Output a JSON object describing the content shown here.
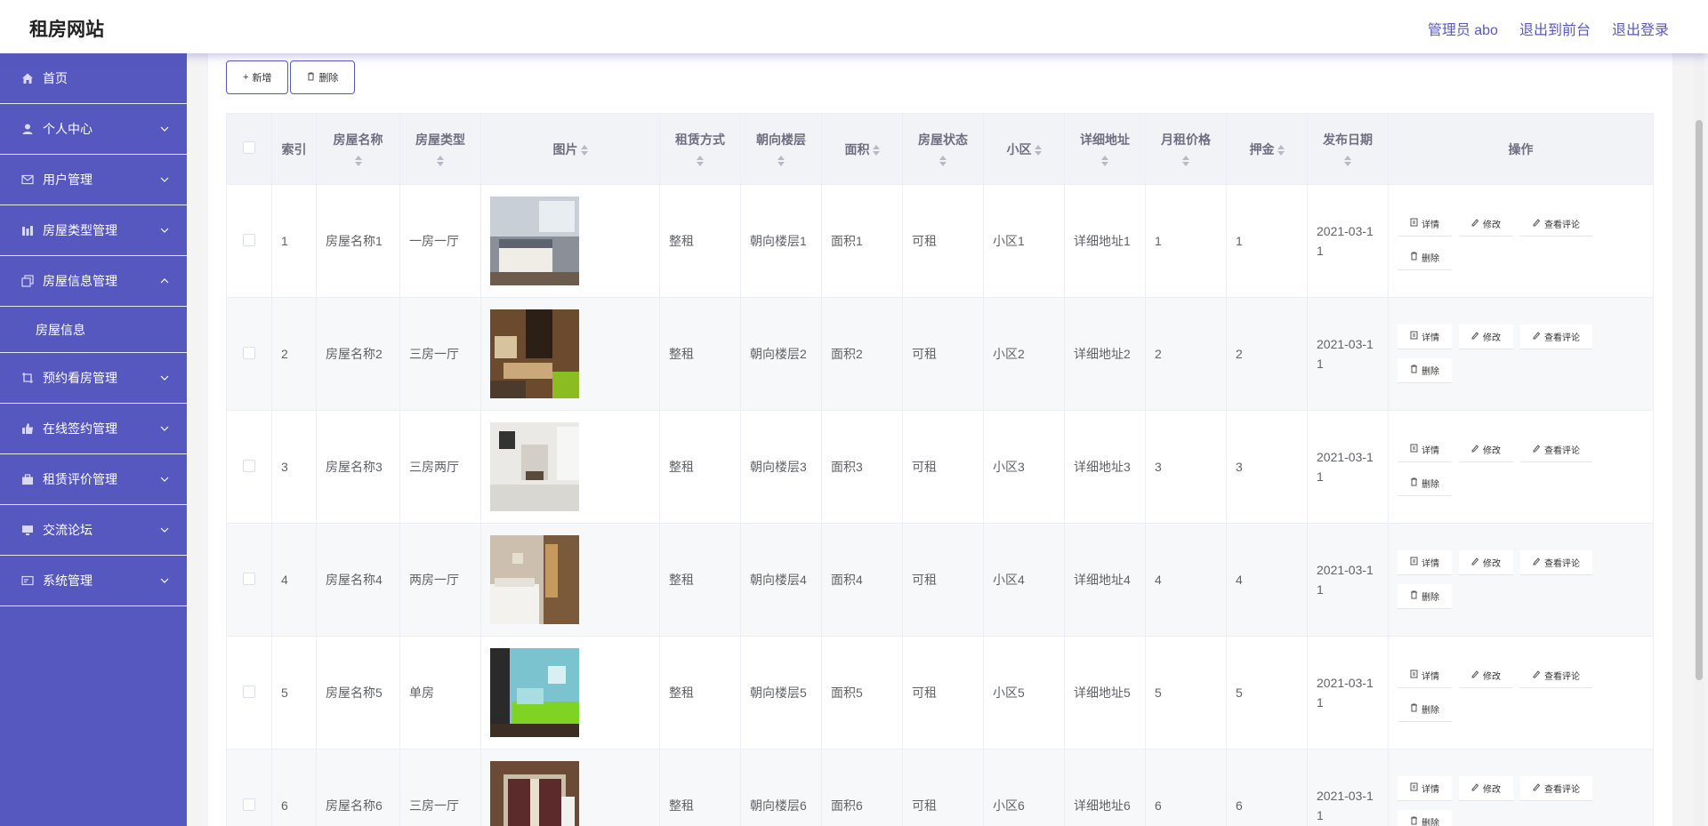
{
  "header": {
    "title": "租房网站",
    "admin": "管理员 abo",
    "to_front": "退出到前台",
    "logout": "退出登录"
  },
  "sidebar": {
    "items": [
      {
        "label": "首页",
        "icon": "home-icon"
      },
      {
        "label": "个人中心",
        "icon": "user-icon"
      },
      {
        "label": "用户管理",
        "icon": "mail-icon"
      },
      {
        "label": "房屋类型管理",
        "icon": "chart-icon"
      },
      {
        "label": "房屋信息管理",
        "icon": "copy-icon"
      },
      {
        "label": "房屋信息"
      },
      {
        "label": "预约看房管理",
        "icon": "crop-icon"
      },
      {
        "label": "在线签约管理",
        "icon": "thumb-icon"
      },
      {
        "label": "租赁评价管理",
        "icon": "briefcase-icon"
      },
      {
        "label": "交流论坛",
        "icon": "monitor-icon"
      },
      {
        "label": "系统管理",
        "icon": "card-icon"
      }
    ]
  },
  "toolbar": {
    "add_label": "新增",
    "delete_label": "删除"
  },
  "table": {
    "headers": [
      "索引",
      "房屋名称",
      "房屋类型",
      "图片",
      "租赁方式",
      "朝向楼层",
      "面积",
      "房屋状态",
      "小区",
      "详细地址",
      "月租价格",
      "押金",
      "发布日期",
      "操作"
    ],
    "rows": [
      {
        "index": "1",
        "name": "房屋名称1",
        "type": "一房一厅",
        "mode": "整租",
        "floor": "朝向楼层1",
        "area": "面积1",
        "status": "可租",
        "community": "小区1",
        "address": "详细地址1",
        "price": "1",
        "deposit": "1",
        "date": "2021-03-1",
        "date2": "1"
      },
      {
        "index": "2",
        "name": "房屋名称2",
        "type": "三房一厅",
        "mode": "整租",
        "floor": "朝向楼层2",
        "area": "面积2",
        "status": "可租",
        "community": "小区2",
        "address": "详细地址2",
        "price": "2",
        "deposit": "2",
        "date": "2021-03-1",
        "date2": "1"
      },
      {
        "index": "3",
        "name": "房屋名称3",
        "type": "三房两厅",
        "mode": "整租",
        "floor": "朝向楼层3",
        "area": "面积3",
        "status": "可租",
        "community": "小区3",
        "address": "详细地址3",
        "price": "3",
        "deposit": "3",
        "date": "2021-03-1",
        "date2": "1"
      },
      {
        "index": "4",
        "name": "房屋名称4",
        "type": "两房一厅",
        "mode": "整租",
        "floor": "朝向楼层4",
        "area": "面积4",
        "status": "可租",
        "community": "小区4",
        "address": "详细地址4",
        "price": "4",
        "deposit": "4",
        "date": "2021-03-1",
        "date2": "1"
      },
      {
        "index": "5",
        "name": "房屋名称5",
        "type": "单房",
        "mode": "整租",
        "floor": "朝向楼层5",
        "area": "面积5",
        "status": "可租",
        "community": "小区5",
        "address": "详细地址5",
        "price": "5",
        "deposit": "5",
        "date": "2021-03-1",
        "date2": "1"
      },
      {
        "index": "6",
        "name": "房屋名称6",
        "type": "三房一厅",
        "mode": "整租",
        "floor": "朝向楼层6",
        "area": "面积6",
        "status": "可租",
        "community": "小区6",
        "address": "详细地址6",
        "price": "6",
        "deposit": "6",
        "date": "2021-03-1",
        "date2": "1"
      }
    ],
    "ops": {
      "detail": "详情",
      "edit": "修改",
      "review": "查看评论",
      "delete": "删除"
    }
  },
  "colors": {
    "sidebar": "#5658bf",
    "accent": "#585ab8"
  }
}
